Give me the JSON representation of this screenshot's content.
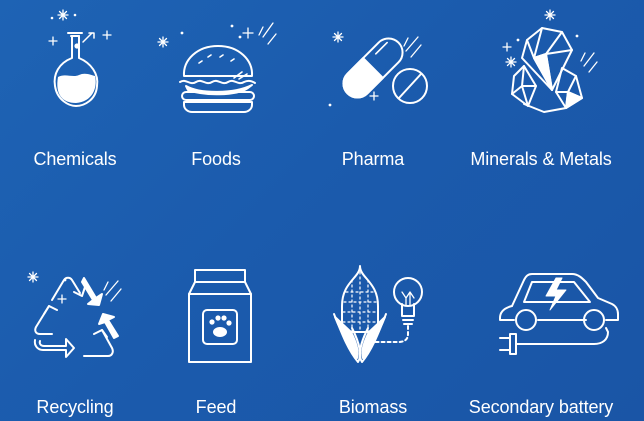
{
  "industries": [
    {
      "id": "chemicals",
      "label": "Chemicals",
      "icon": "flask-icon"
    },
    {
      "id": "foods",
      "label": "Foods",
      "icon": "burger-icon"
    },
    {
      "id": "pharma",
      "label": "Pharma",
      "icon": "pill-capsule-icon"
    },
    {
      "id": "minerals",
      "label": "Minerals & Metals",
      "icon": "crystal-icon"
    },
    {
      "id": "recycling",
      "label": "Recycling",
      "icon": "recycle-icon"
    },
    {
      "id": "feed",
      "label": "Feed",
      "icon": "feed-bag-icon"
    },
    {
      "id": "biomass",
      "label": "Biomass",
      "icon": "corn-bulb-icon"
    },
    {
      "id": "battery",
      "label": "Secondary battery",
      "icon": "electric-car-icon"
    }
  ],
  "colors": {
    "background": "#1c5caf",
    "icon_line": "#ffffff"
  }
}
